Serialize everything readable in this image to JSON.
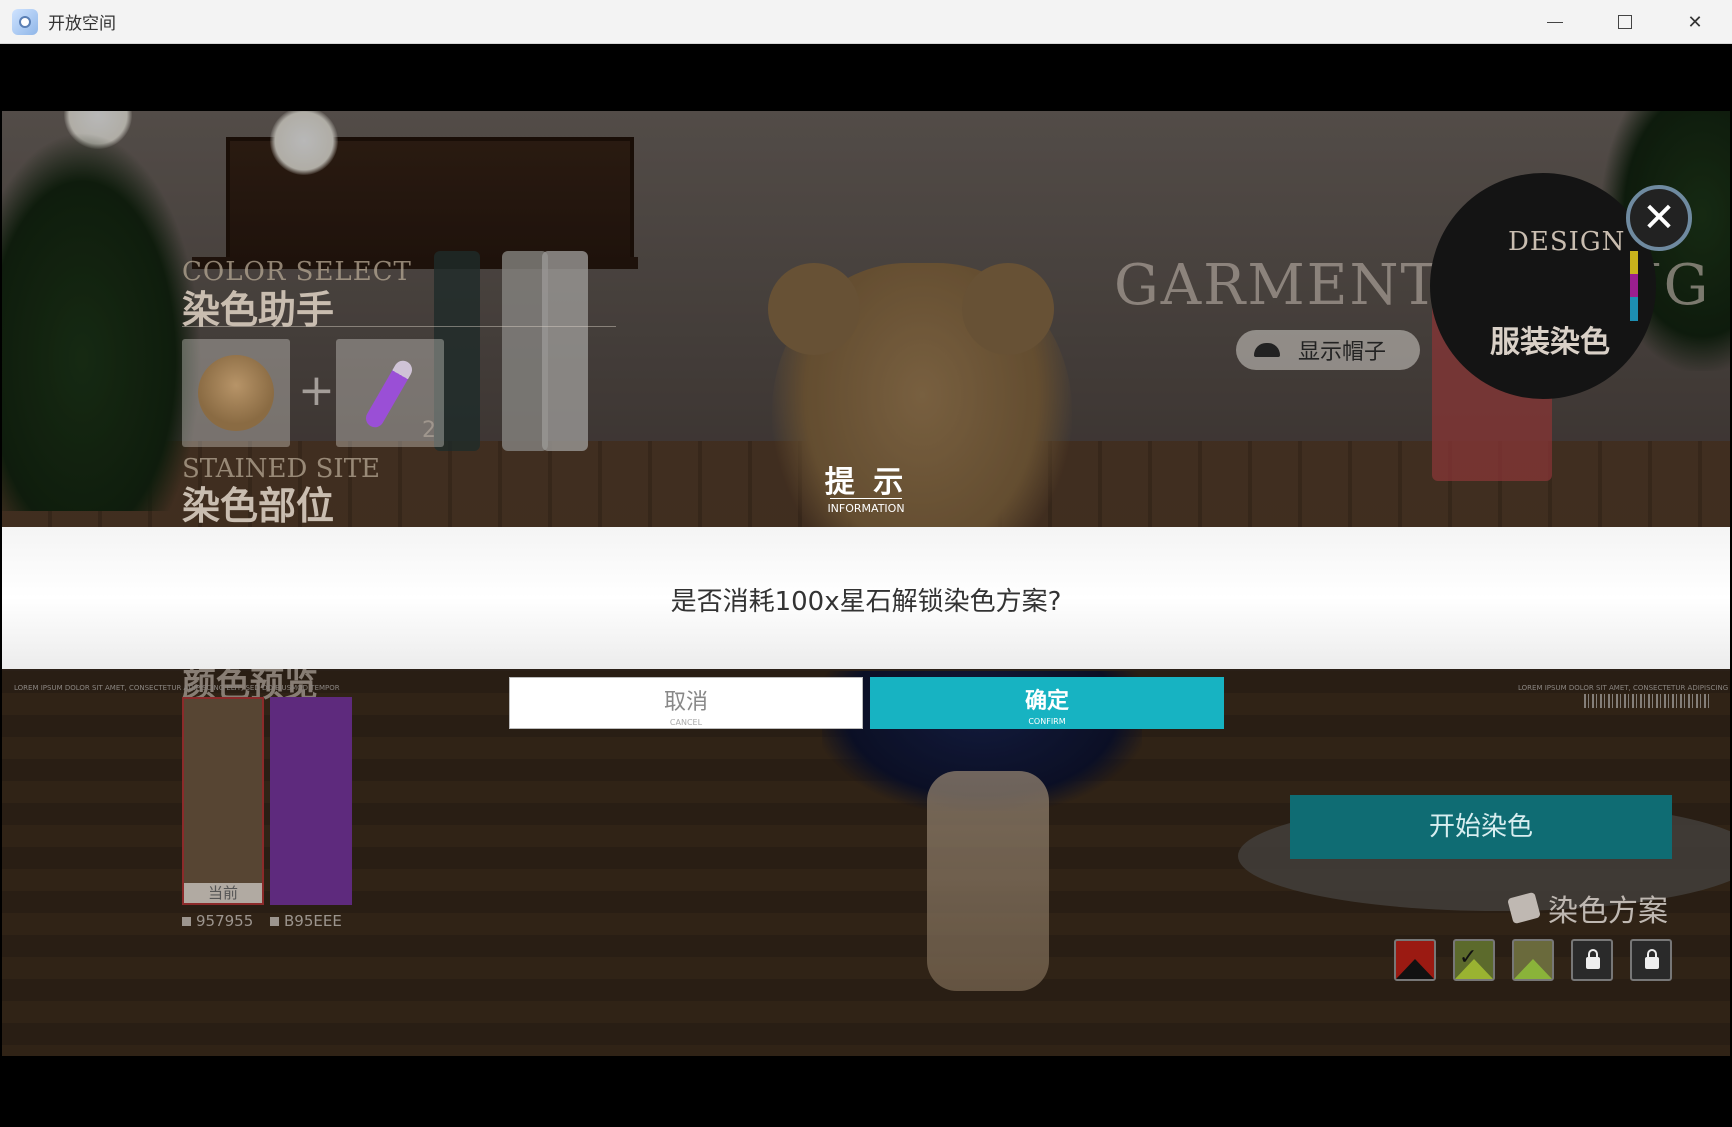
{
  "window": {
    "title": "开放空间",
    "min_icon": "minimize-icon",
    "max_icon": "maximize-icon",
    "close_icon": "close-icon"
  },
  "left_panel": {
    "color_select_en": "COLOR SELECT",
    "color_select_cn": "染色助手",
    "potion_count": "2",
    "stained_site_en": "STAINED SITE",
    "stained_site_cn": "染色部位"
  },
  "right_panel": {
    "design_label": "DESIGN",
    "garment_title": "GARMENT DYEING",
    "garment_cn": "服装染色",
    "hat_toggle_label": "显示帽子"
  },
  "dialog": {
    "title": "提 示",
    "subtitle": "INFORMATION",
    "message": "是否消耗100x星石解锁染色方案?",
    "cancel_label": "取消",
    "cancel_sub": "CANCEL",
    "confirm_label": "确定",
    "confirm_sub": "CONFIRM"
  },
  "color_preview": {
    "lorem_left": "LOREM IPSUM DOLOR SIT AMET, CONSECTETUR ADIPISCING ELIT, SED DO EIUSMOD TEMPOR",
    "lorem_right": "LOREM IPSUM DOLOR SIT AMET, CONSECTETUR ADIPISCING ELIT",
    "swatches": [
      {
        "hex": "957955",
        "color": "#574533",
        "caption": "当前"
      },
      {
        "hex": "B95EEE",
        "color": "#5e2a7d",
        "caption": ""
      }
    ]
  },
  "actions": {
    "start_dye_label": "开始染色",
    "scheme_label": "染色方案"
  },
  "schemes": [
    {
      "state": "color",
      "color": "#9b1a12",
      "accent": "#111111"
    },
    {
      "state": "selected",
      "color": "#5c6a2c",
      "accent": "#9ab331"
    },
    {
      "state": "color",
      "color": "#6a6a3c",
      "accent": "#8ab33a"
    },
    {
      "state": "locked"
    },
    {
      "state": "locked"
    }
  ],
  "colors": {
    "accent_teal": "#17b3c2",
    "start_button": "#0f6c73"
  }
}
